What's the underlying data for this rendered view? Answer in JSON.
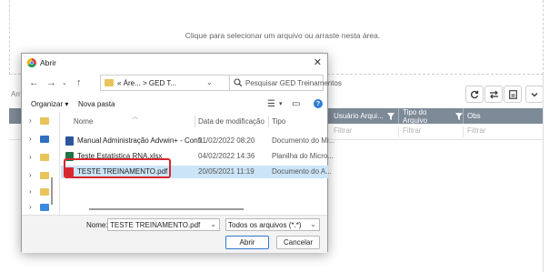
{
  "app": {
    "dropzone_text": "Clique para selecionar um arquivo ou arraste nesta área.",
    "partial_label": "Arr",
    "grid_columns": [
      {
        "label": "Usuário Arqui...",
        "filter": "Filtrar"
      },
      {
        "label": "Tipo do Arquivo",
        "filter": "Filtrar"
      },
      {
        "label": "Obs",
        "filter": "Filtrar"
      }
    ],
    "toolbar_icons": [
      "refresh-icon",
      "swap-icon",
      "export-icon",
      "chevron-down-icon"
    ],
    "header_color": "#7d8a97"
  },
  "dialog": {
    "title": "Abrir",
    "address": "« Áre... > GED T...",
    "search_placeholder": "Pesquisar GED Treinamentos",
    "organize_label": "Organizar ▾",
    "new_folder_label": "Nova pasta",
    "columns": {
      "name": "Nome",
      "date": "Data de modificação",
      "type": "Tipo"
    },
    "files": [
      {
        "name": "Manual Administração Advwin+ - Confi...",
        "date": "01/02/2022 08:20",
        "type": "Documento do Mi...",
        "icon": "word-icon",
        "color": "#2b579a"
      },
      {
        "name": "Teste Estatística RNA.xlsx",
        "date": "04/02/2022 14:36",
        "type": "Planilha do Micro...",
        "icon": "excel-icon",
        "color": "#217346"
      },
      {
        "name": "TESTE TREINAMENTO.pdf",
        "date": "20/05/2021 11:19",
        "type": "Documento do A...",
        "icon": "pdf-icon",
        "color": "#d9262c"
      }
    ],
    "selected_index": 2,
    "filename_label": "Nome:",
    "filename_value": "TESTE TREINAMENTO.pdf",
    "filetype_value": "Todos os arquivos (*.*)",
    "open_label": "Abrir",
    "cancel_label": "Cancelar",
    "highlight_color": "#d9262c",
    "selection_color": "#cce4f7"
  }
}
